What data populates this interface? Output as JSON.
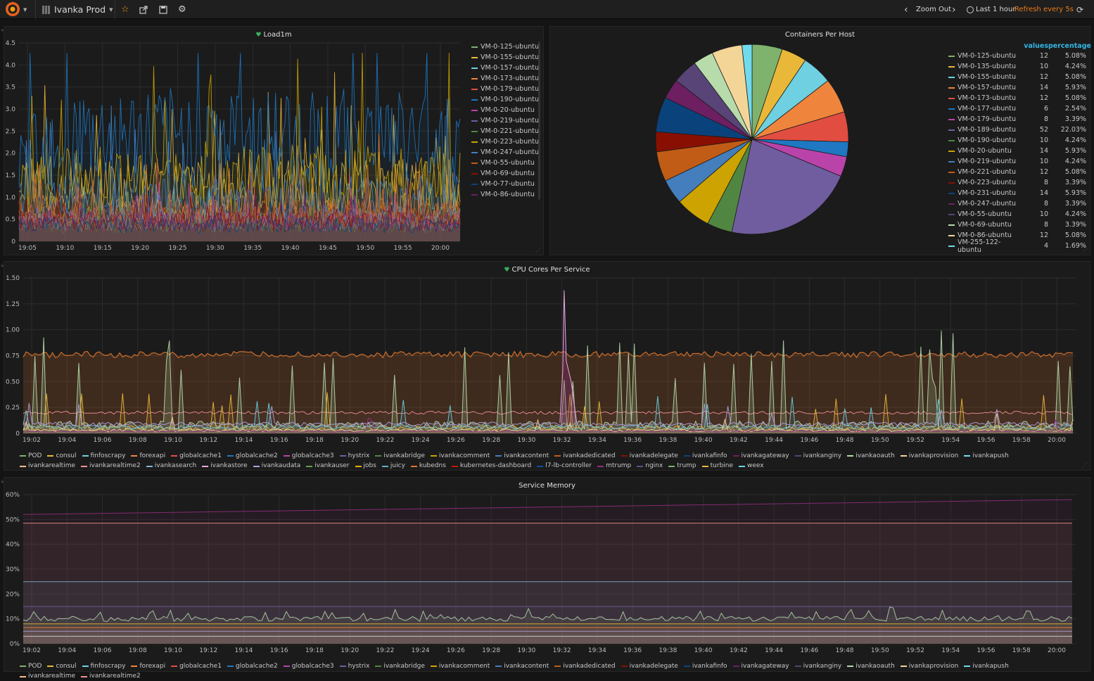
{
  "topbar": {
    "dashboard_title": "Ivanka Prod",
    "zoom_out": "Zoom Out",
    "time_range": "Last 1 hour",
    "refresh": "Refresh every 5s"
  },
  "colors": {
    "accent": "#eb7b18",
    "heart": "#3bb15f",
    "link": "#33b5e5",
    "palette": [
      "#7eb26d",
      "#eab839",
      "#6ed0e0",
      "#ef843c",
      "#e24d42",
      "#1f78c1",
      "#ba43a9",
      "#705da0",
      "#508642",
      "#cca300",
      "#447ebc",
      "#c15c17",
      "#890f02",
      "#0a437c",
      "#6d1f62",
      "#584477",
      "#b7dbab",
      "#f4d598",
      "#70dbed",
      "#f9ba8f",
      "#f29191",
      "#82b5d8",
      "#e5a8e2",
      "#aea2e0",
      "#629e51",
      "#e5ac0e",
      "#64b0c8",
      "#e0752d",
      "#bf1b00",
      "#0a50a1",
      "#962d82",
      "#614d93"
    ]
  },
  "load_panel": {
    "title": "Load1m",
    "chart_data": {
      "type": "line",
      "title": "Load1m",
      "ylim": [
        0,
        4.5
      ],
      "y_ticks": [
        "0",
        "0.5",
        "1.0",
        "1.5",
        "2.0",
        "2.5",
        "3.0",
        "3.5",
        "4.0",
        "4.5"
      ],
      "x_ticks": [
        "19:05",
        "19:10",
        "19:15",
        "19:20",
        "19:25",
        "19:30",
        "19:35",
        "19:40",
        "19:45",
        "19:50",
        "19:55",
        "20:00"
      ],
      "series_names": [
        "VM-0-125-ubuntu",
        "VM-0-155-ubuntu",
        "VM-0-157-ubuntu",
        "VM-0-173-ubuntu",
        "VM-0-179-ubuntu",
        "VM-0-190-ubuntu",
        "VM-0-20-ubuntu",
        "VM-0-219-ubuntu",
        "VM-0-221-ubuntu",
        "VM-0-223-ubuntu",
        "VM-0-247-ubuntu",
        "VM-0-55-ubuntu",
        "VM-0-69-ubuntu",
        "VM-0-77-ubuntu",
        "VM-0-86-ubuntu"
      ],
      "series_colors": [
        "#7eb26d",
        "#eab839",
        "#6ed0e0",
        "#ef843c",
        "#e24d42",
        "#1f78c1",
        "#ba43a9",
        "#705da0",
        "#508642",
        "#cca300",
        "#447ebc",
        "#c15c17",
        "#890f02",
        "#0a437c",
        "#6d1f62"
      ],
      "series_levels": [
        0.6,
        1.4,
        0.5,
        0.8,
        0.7,
        2.6,
        0.5,
        0.6,
        0.4,
        1.6,
        1.1,
        0.7,
        0.5,
        0.4,
        0.5
      ],
      "grid": true,
      "legend": "right"
    }
  },
  "pie_panel": {
    "title": "Containers Per Host",
    "col_values": "values",
    "col_percentage": "percentage",
    "chart_data": {
      "type": "pie",
      "title": "Containers Per Host",
      "labels": [
        "VM-0-125-ubuntu",
        "VM-0-135-ubuntu",
        "VM-0-155-ubuntu",
        "VM-0-157-ubuntu",
        "VM-0-173-ubuntu",
        "VM-0-177-ubuntu",
        "VM-0-179-ubuntu",
        "VM-0-189-ubuntu",
        "VM-0-190-ubuntu",
        "VM-0-20-ubuntu",
        "VM-0-219-ubuntu",
        "VM-0-221-ubuntu",
        "VM-0-223-ubuntu",
        "VM-0-231-ubuntu",
        "VM-0-247-ubuntu",
        "VM-0-55-ubuntu",
        "VM-0-69-ubuntu",
        "VM-0-86-ubuntu",
        "VM-255-122-ubuntu"
      ],
      "values": [
        12,
        10,
        12,
        14,
        12,
        6,
        8,
        52,
        10,
        14,
        10,
        12,
        8,
        14,
        8,
        10,
        8,
        12,
        4
      ],
      "percentages": [
        "5.08%",
        "4.24%",
        "5.08%",
        "5.93%",
        "5.08%",
        "2.54%",
        "3.39%",
        "22.03%",
        "4.24%",
        "5.93%",
        "4.24%",
        "5.08%",
        "3.39%",
        "5.93%",
        "3.39%",
        "4.24%",
        "3.39%",
        "5.08%",
        "1.69%"
      ],
      "colors": [
        "#7eb26d",
        "#eab839",
        "#6ed0e0",
        "#ef843c",
        "#e24d42",
        "#1f78c1",
        "#ba43a9",
        "#705da0",
        "#508642",
        "#cca300",
        "#447ebc",
        "#c15c17",
        "#890f02",
        "#0a437c",
        "#6d1f62",
        "#584477",
        "#b7dbab",
        "#f4d598",
        "#70dbed"
      ],
      "legend": "right"
    }
  },
  "cpu_panel": {
    "title": "CPU Cores Per Service",
    "chart_data": {
      "type": "area",
      "title": "CPU Cores Per Service",
      "ylim": [
        0,
        1.5
      ],
      "y_ticks": [
        "0",
        "0.25",
        "0.50",
        "0.75",
        "1.00",
        "1.25",
        "1.50"
      ],
      "x_ticks": [
        "19:02",
        "19:04",
        "19:06",
        "19:08",
        "19:10",
        "19:12",
        "19:14",
        "19:16",
        "19:18",
        "19:20",
        "19:22",
        "19:24",
        "19:26",
        "19:28",
        "19:30",
        "19:32",
        "19:34",
        "19:36",
        "19:38",
        "19:40",
        "19:42",
        "19:44",
        "19:46",
        "19:48",
        "19:50",
        "19:52",
        "19:54",
        "19:56",
        "19:58",
        "20:00"
      ],
      "series_names": [
        "POD",
        "consul",
        "finfoscrapy",
        "forexapi",
        "globalcache1",
        "globalcache2",
        "globalcache3",
        "hystrix",
        "ivankabridge",
        "ivankacomment",
        "ivankacontent",
        "ivankadedicated",
        "ivankadelegate",
        "ivankafinfo",
        "ivankagateway",
        "ivankanginy",
        "ivankaoauth",
        "ivankaprovision",
        "ivankapush",
        "ivankarealtime",
        "ivankarealtime2",
        "ivankasearch",
        "ivankastore",
        "ivankaudata",
        "ivankauser",
        "jobs",
        "juicy",
        "kubedns",
        "kubernetes-dashboard",
        "l7-lb-controller",
        "mtrump",
        "nginx",
        "trump",
        "turbine",
        "weex"
      ],
      "grid": true,
      "legend": "bottom"
    }
  },
  "mem_panel": {
    "title": "Service Memory",
    "chart_data": {
      "type": "area",
      "title": "Service Memory",
      "ylim": [
        0,
        60
      ],
      "y_ticks": [
        "0%",
        "10%",
        "20%",
        "30%",
        "40%",
        "50%",
        "60%"
      ],
      "x_ticks": [
        "19:02",
        "19:04",
        "19:06",
        "19:08",
        "19:10",
        "19:12",
        "19:14",
        "19:16",
        "19:18",
        "19:20",
        "19:22",
        "19:24",
        "19:26",
        "19:28",
        "19:30",
        "19:32",
        "19:34",
        "19:36",
        "19:38",
        "19:40",
        "19:42",
        "19:44",
        "19:46",
        "19:48",
        "19:50",
        "19:52",
        "19:54",
        "19:56",
        "19:58",
        "20:00"
      ],
      "series_names": [
        "POD",
        "consul",
        "finfoscrapy",
        "forexapi",
        "globalcache1",
        "globalcache2",
        "globalcache3",
        "hystrix",
        "ivankabridge",
        "ivankacomment",
        "ivankacontent",
        "ivankadedicated",
        "ivankadelegate",
        "ivankafinfo",
        "ivankagateway",
        "ivankanginy",
        "ivankaoauth",
        "ivankaprovision",
        "ivankapush",
        "ivankarealtime",
        "ivankarealtime2"
      ],
      "levels": [
        {
          "value": 52,
          "end": 58,
          "color": "#962d82"
        },
        {
          "value": 48.5,
          "end": 48.5,
          "color": "#f29191"
        },
        {
          "value": 25,
          "end": 25,
          "color": "#82b5d8"
        },
        {
          "value": 15,
          "end": 15,
          "color": "#705da0"
        },
        {
          "value": 10,
          "end": 10,
          "color": "#b7dbab",
          "noisy": true
        },
        {
          "value": 8,
          "end": 8,
          "color": "#eab839"
        },
        {
          "value": 6.5,
          "end": 6.5,
          "color": "#ef843c"
        },
        {
          "value": 5,
          "end": 5,
          "color": "#aea2e0"
        },
        {
          "value": 3,
          "end": 3,
          "color": "#d8d9da"
        }
      ],
      "grid": true,
      "legend": "bottom"
    }
  }
}
